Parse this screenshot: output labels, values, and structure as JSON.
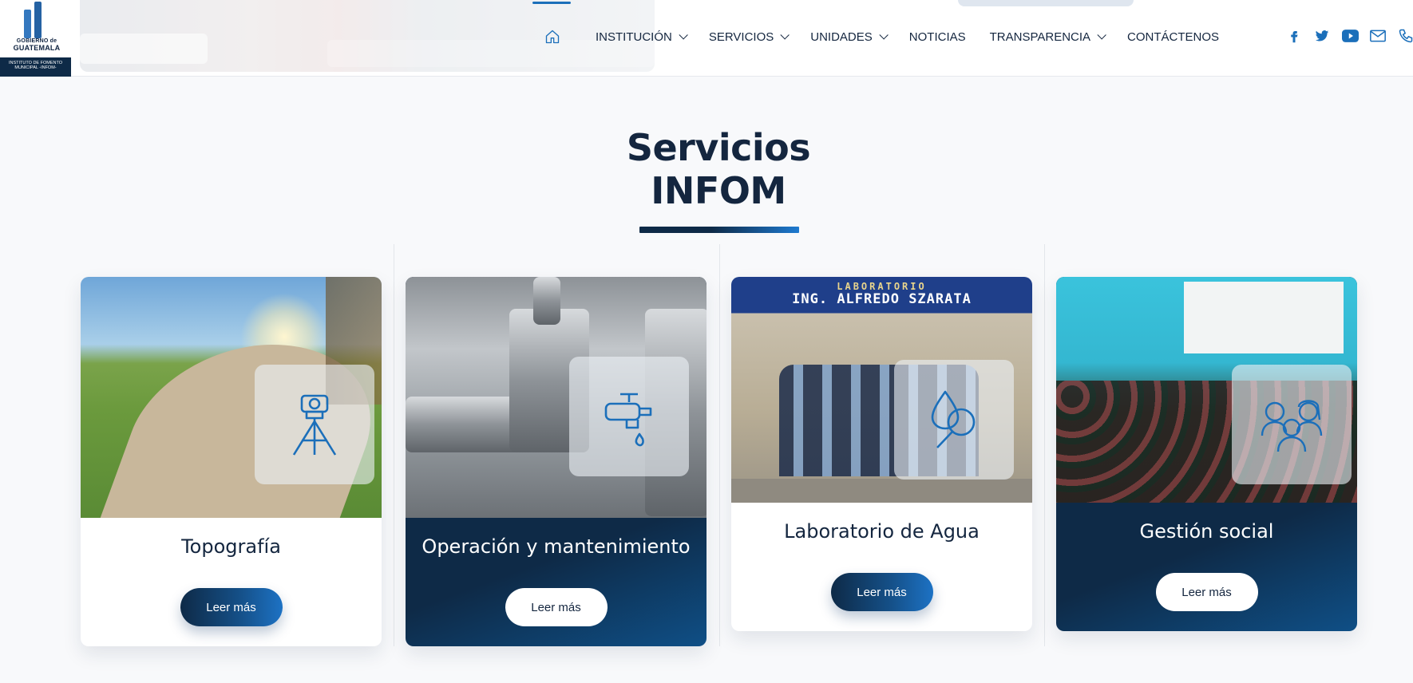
{
  "header": {
    "logo": {
      "line1": "GOBIERNO de",
      "line2": "GUATEMALA",
      "band": "INSTITUTO DE FOMENTO MUNICIPAL -INFOM-"
    },
    "nav": [
      {
        "label": "INSTITUCIÓN",
        "has_dropdown": true
      },
      {
        "label": "SERVICIOS",
        "has_dropdown": true
      },
      {
        "label": "UNIDADES",
        "has_dropdown": true
      },
      {
        "label": "NOTICIAS",
        "has_dropdown": false
      },
      {
        "label": "TRANSPARENCIA",
        "has_dropdown": true
      },
      {
        "label": "CONTÁCTENOS",
        "has_dropdown": false
      }
    ],
    "icons": {
      "home": "home-icon",
      "social": [
        "facebook-icon",
        "twitter-icon",
        "youtube-icon",
        "mail-icon",
        "phone-icon"
      ]
    }
  },
  "section": {
    "title_line1": "Servicios",
    "title_line2": "INFOM"
  },
  "cards": [
    {
      "name": "Topografía",
      "button": "Leer más",
      "icon": "surveying-instrument-icon"
    },
    {
      "name": "Operación y mantenimiento",
      "button": "Leer más",
      "icon": "water-faucet-icon"
    },
    {
      "name": "Laboratorio de Agua",
      "button": "Leer más",
      "icon": "water-drop-magnifier-icon",
      "photo_sign_line1": "LABORATORIO",
      "photo_sign_line2": "ING. ALFREDO SZARATA"
    },
    {
      "name": "Gestión social",
      "button": "Leer más",
      "icon": "people-group-icon"
    }
  ],
  "colors": {
    "navy": "#0e2a47",
    "accent_blue": "#1d72c4",
    "icon_blue": "#1b6fba"
  }
}
